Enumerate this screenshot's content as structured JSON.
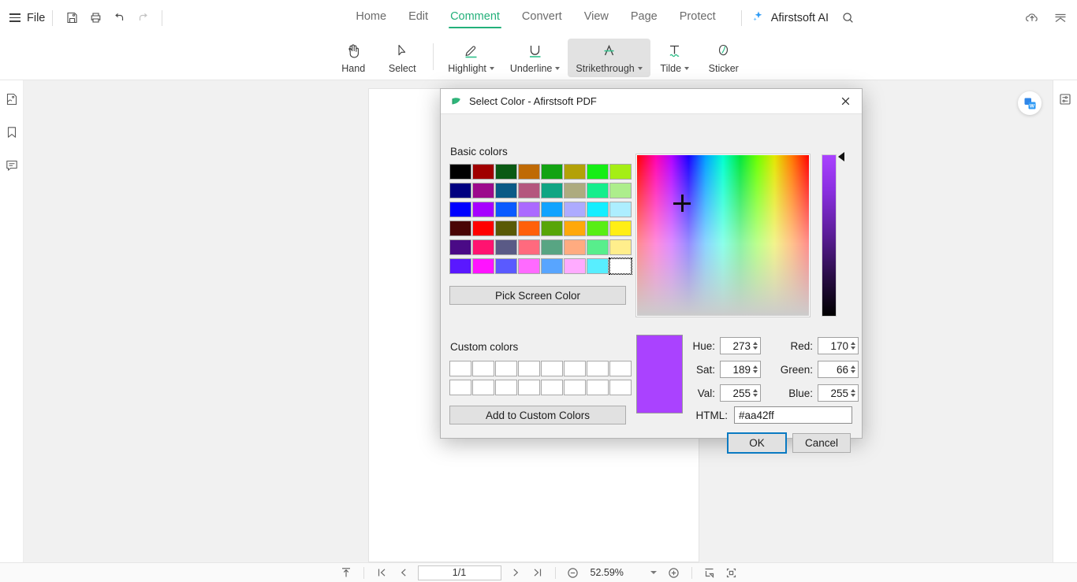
{
  "app": {
    "file_menu": "File",
    "brand": "Afirstsoft PDF"
  },
  "quick_access": [
    {
      "name": "save-icon",
      "label": "Save"
    },
    {
      "name": "print-icon",
      "label": "Print"
    },
    {
      "name": "undo-icon",
      "label": "Undo"
    },
    {
      "name": "redo-icon",
      "label": "Redo"
    }
  ],
  "tabs": [
    {
      "label": "Home",
      "active": false
    },
    {
      "label": "Edit",
      "active": false
    },
    {
      "label": "Comment",
      "active": true
    },
    {
      "label": "Convert",
      "active": false
    },
    {
      "label": "View",
      "active": false
    },
    {
      "label": "Page",
      "active": false
    },
    {
      "label": "Protect",
      "active": false
    }
  ],
  "ai": {
    "label": "Afirstsoft AI"
  },
  "accent_color": "#23b07a",
  "ribbon": {
    "tools": [
      {
        "label": "Hand",
        "icon": "hand-icon",
        "dropdown": false,
        "selected": false
      },
      {
        "label": "Select",
        "icon": "cursor-icon",
        "dropdown": false,
        "selected": false
      },
      {
        "label": "Highlight",
        "icon": "highlighter-icon",
        "dropdown": true,
        "selected": false
      },
      {
        "label": "Underline",
        "icon": "underline-icon",
        "dropdown": true,
        "selected": false
      },
      {
        "label": "Strikethrough",
        "icon": "strikethrough-icon",
        "dropdown": true,
        "selected": true
      },
      {
        "label": "Tilde",
        "icon": "tilde-icon",
        "dropdown": true,
        "selected": false
      },
      {
        "label": "Sticker",
        "icon": "sticker-icon",
        "dropdown": false,
        "selected": false
      }
    ]
  },
  "left_rail": [
    {
      "name": "thumbnails-icon"
    },
    {
      "name": "bookmarks-icon"
    },
    {
      "name": "comments-icon"
    }
  ],
  "status_bar": {
    "page_value": "1/1",
    "zoom_value": "52.59%"
  },
  "dialog": {
    "title": "Select Color - Afirstsoft PDF",
    "basic_colors_label": "Basic colors",
    "custom_colors_label": "Custom colors",
    "pick_screen_color": "Pick Screen Color",
    "add_to_custom_colors": "Add to Custom Colors",
    "html_label": "HTML:",
    "html_value": "#aa42ff",
    "ok_label": "OK",
    "cancel_label": "Cancel",
    "preview_color": "#aa42ff",
    "selected_swatch_index": 47,
    "basic_colors": [
      "#000000",
      "#a00000",
      "#0a5a14",
      "#bf6a05",
      "#13a313",
      "#b3a108",
      "#15ee15",
      "#a5ee15",
      "#000080",
      "#9c0a8c",
      "#0a5a86",
      "#b4577e",
      "#10a583",
      "#adab7f",
      "#15ee8c",
      "#adee8c",
      "#0000ff",
      "#a600ff",
      "#0a5aff",
      "#ab6aff",
      "#10a3ff",
      "#adabff",
      "#15eeff",
      "#adeeff",
      "#4a0505",
      "#ff0000",
      "#5a5a05",
      "#ff600a",
      "#58a508",
      "#ffa80a",
      "#58ee15",
      "#ffee15",
      "#4a0a86",
      "#ff1370",
      "#5a5a86",
      "#ff6a7e",
      "#58a583",
      "#ffab80",
      "#58ee8c",
      "#ffee8c",
      "#5a18ff",
      "#ff13ff",
      "#5a5aff",
      "#ff6aff",
      "#58a5ff",
      "#ffabff",
      "#58eeff",
      "#ffffff"
    ],
    "custom_colors": [
      "",
      "",
      "",
      "",
      "",
      "",
      "",
      "",
      "",
      "",
      "",
      "",
      "",
      "",
      "",
      ""
    ],
    "fields": [
      {
        "label": "Hue:",
        "value": "273",
        "name": "hue-field"
      },
      {
        "label": "Red:",
        "value": "170",
        "name": "red-field"
      },
      {
        "label": "Sat:",
        "value": "189",
        "name": "sat-field"
      },
      {
        "label": "Green:",
        "value": "66",
        "name": "green-field"
      },
      {
        "label": "Val:",
        "value": "255",
        "name": "val-field"
      },
      {
        "label": "Blue:",
        "value": "255",
        "name": "blue-field"
      }
    ]
  }
}
